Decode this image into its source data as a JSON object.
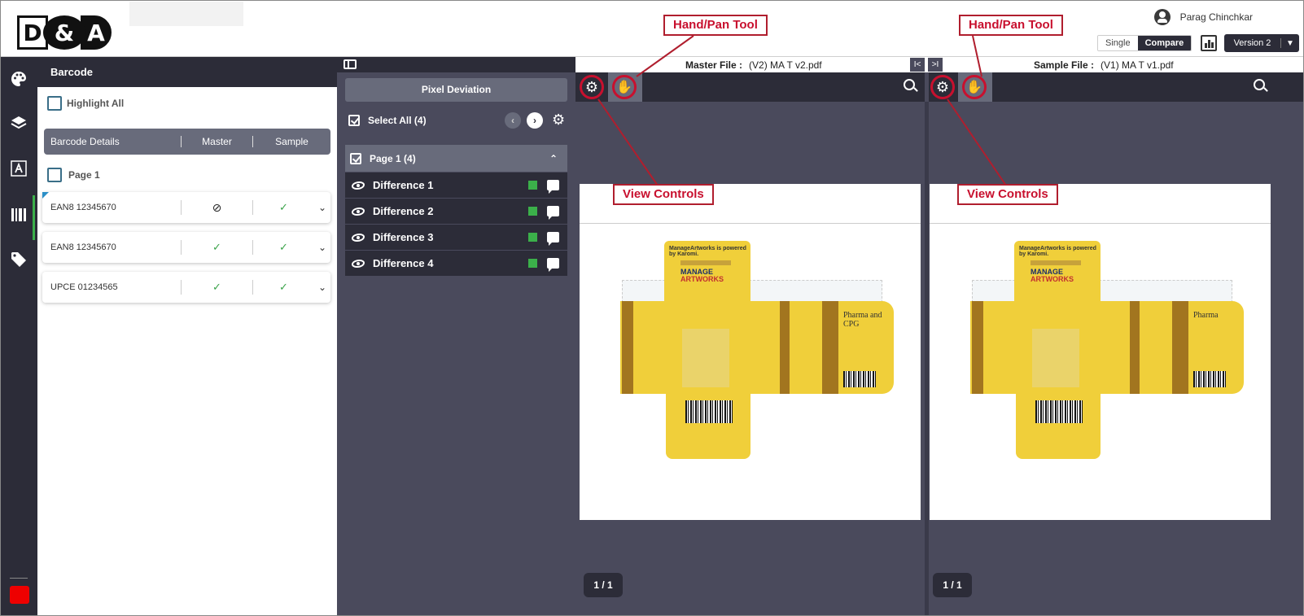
{
  "header": {
    "logo": {
      "d": "D",
      "amp": "&",
      "a": "A"
    },
    "user_name": "Parag Chinchkar",
    "view_toggle": {
      "single": "Single",
      "compare": "Compare"
    },
    "version_label": "Version 2"
  },
  "rail": {
    "icons": [
      "palette-icon",
      "layers-icon",
      "text-icon",
      "barcode-icon",
      "tag-icon"
    ],
    "active_item": "barcode-icon",
    "accent_color": "#3bb04a",
    "status_color": "#e00000"
  },
  "barcode_panel": {
    "title": "Barcode",
    "highlight_all": "Highlight All",
    "columns": {
      "details": "Barcode Details",
      "master": "Master",
      "sample": "Sample"
    },
    "page_label": "Page 1",
    "rows": [
      {
        "name": "EAN8 12345670",
        "master": "blocked",
        "sample": "ok",
        "master_glyph": "⊘",
        "sample_glyph": "✓",
        "expand_glyph": "⌄"
      },
      {
        "name": "EAN8 12345670",
        "master": "ok",
        "sample": "ok",
        "master_glyph": "✓",
        "sample_glyph": "✓",
        "expand_glyph": "⌄"
      },
      {
        "name": "UPCE 01234565",
        "master": "ok",
        "sample": "ok",
        "master_glyph": "✓",
        "sample_glyph": "✓",
        "expand_glyph": "⌄"
      }
    ]
  },
  "diff_panel": {
    "mode_button": "Pixel Deviation",
    "select_all": "Select All (4)",
    "prev_glyph": "‹",
    "next_glyph": "›",
    "page_group": "Page 1 (4)",
    "collapse_glyph": "⌃",
    "differences": [
      "Difference 1",
      "Difference 2",
      "Difference 3",
      "Difference 4"
    ],
    "marker_color": "#3bb04a"
  },
  "viewer": {
    "master_label": "Master File :",
    "master_file": "(V2) MA T v2.pdf",
    "sample_label": "Sample File :",
    "sample_file": "(V1) MA T v1.pdf",
    "nav_first": "I<",
    "nav_last": ">I",
    "master_page": "1 / 1",
    "sample_page": "1 / 1",
    "master_artwork": {
      "powered": "ManageArtworks is powered by Karomi.",
      "brand_top": "MANAGE",
      "brand_bottom": "ARTWORKS",
      "side_text": "Pharma and CPG"
    },
    "sample_artwork": {
      "powered": "ManageArtworks is powered by Karomi.",
      "brand_top": "MANAGE",
      "brand_bottom": "ARTWORKS",
      "side_text": "Pharma"
    }
  },
  "annotations": {
    "hand_tool_left": "Hand/Pan Tool",
    "hand_tool_right": "Hand/Pan Tool",
    "view_controls_left": "View Controls",
    "view_controls_right": "View Controls",
    "color": "#c8102e"
  }
}
